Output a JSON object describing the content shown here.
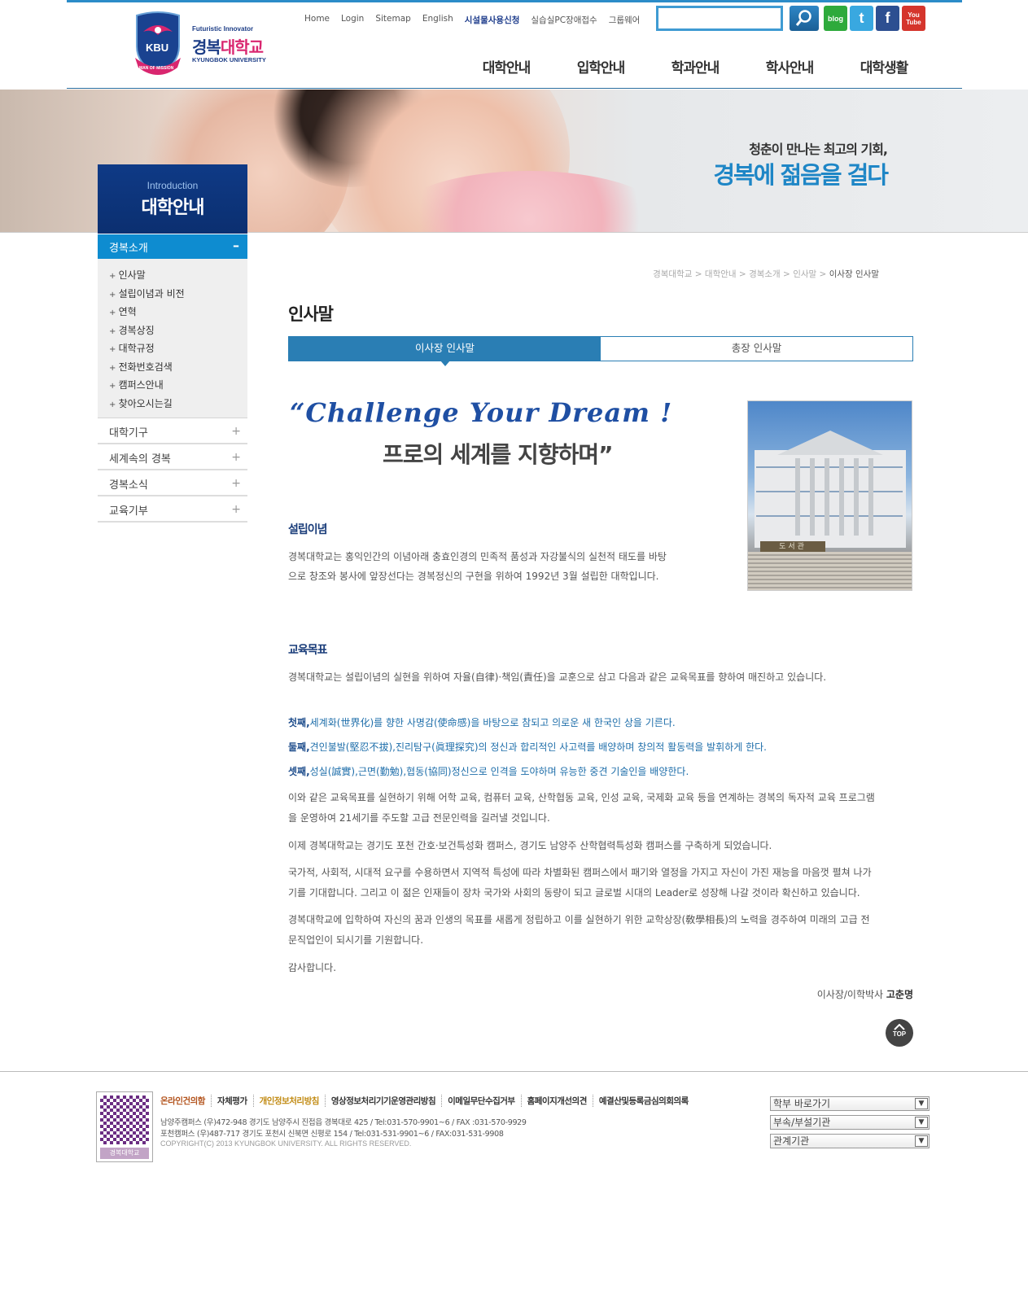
{
  "header": {
    "logo": {
      "sub": "Futuristic Innovator",
      "main_a": "경복",
      "main_b": "대학교",
      "eng": "KYUNGBOK UNIVERSITY",
      "emblem_text": "KBU",
      "ribbon_text": "MAN OF MISSION"
    },
    "util_links": [
      "Home",
      "Login",
      "Sitemap",
      "English",
      "시설물사용신청",
      "실습실PC장애접수",
      "그룹웨어"
    ],
    "search": {
      "placeholder": ""
    },
    "sns": [
      "blog",
      "t",
      "f",
      "You Tube"
    ],
    "gnb": [
      "대학안내",
      "입학안내",
      "학과안내",
      "학사안내",
      "대학생활"
    ]
  },
  "banner": {
    "copy1": "청춘이 만나는 최고의 기회,",
    "copy2": "경복에 젊음을 걸다",
    "section_en": "Introduction",
    "section_ko": "대학안내"
  },
  "lnb": {
    "head": "경복소개",
    "head_toggle": "–",
    "sub": [
      "인사말",
      "설립이념과 비전",
      "연혁",
      "경복상징",
      "대학규정",
      "전화번호검색",
      "캠퍼스안내",
      "찾아오시는길"
    ],
    "items": [
      "대학기구",
      "세계속의 경복",
      "경복소식",
      "교육기부"
    ],
    "toggle": "+"
  },
  "location": {
    "crumbs": [
      "경복대학교",
      "대학안내",
      "경복소개",
      "인사말"
    ],
    "current": "이사장 인사말",
    "sep": ">"
  },
  "content": {
    "title": "인사말",
    "tabs": [
      "이사장 인사말",
      "총장 인사말"
    ],
    "slogan_en": "“Challenge Your Dream !",
    "slogan_ko": "프로의 세계를 지향하며”",
    "photo_sign": "도서관",
    "s1_title": "설립이념",
    "s1_p1": "경복대학교는 홍익인간의 이념아래 충효인경의 민족적 품성과 자강불식의 실천적 태도를 바탕",
    "s1_p2": "으로 창조와 봉사에 앞장선다는 경복정신의 구현을 위하여 1992년 3월 설립한 대학입니다.",
    "s2_title": "교육목표",
    "s2_intro": "경복대학교는 설립이념의 실현을 위하여 자율(自律)·책임(責任)을 교훈으로 삼고 다음과 같은 교육목표를 향하여 매진하고 있습니다.",
    "goals": [
      {
        "num": "첫째,",
        "text": "세계화(世界化)를 향한 사명감(使命感)을 바탕으로 참되고 의로운 새 한국인 상을 기른다."
      },
      {
        "num": "둘째,",
        "text": "견인불발(堅忍不拔),진리탐구(眞理探究)의 정신과 합리적인 사고력를 배양하며 창의적 활동력을 발휘하게 한다."
      },
      {
        "num": "셋째,",
        "text": "성실(誠實),근면(勤勉),협동(協同)정신으로 인격을 도야하며 유능한 중견 기술인을 배양한다."
      }
    ],
    "p3a": "이와 같은 교육목표를 실현하기 위해 어학 교육, 컴퓨터 교육, 산학협동 교육, 인성 교육, 국제화 교육 등을 연계하는 경복의 독자적 교육 프로그램",
    "p3b": "을 운영하여 21세기를 주도할 고급 전문인력을 길러낼 것입니다.",
    "p4": "이제 경복대학교는 경기도 포천 간호·보건특성화 캠퍼스, 경기도 남양주 산학협력특성화 캠퍼스를 구축하게 되었습니다.",
    "p5a": "국가적, 사회적, 시대적 요구를 수용하면서 지역적 특성에 따라 차별화된 캠퍼스에서 패기와 열정을 가지고 자신이 가진 재능을 마음껏 펼쳐 나가",
    "p5b": "기를 기대합니다. 그리고 이 젊은 인재들이 장차 국가와 사회의 동량이 되고 글로벌 시대의 Leader로 성장해 나갈 것이라 확신하고 있습니다.",
    "p6a": " 경복대학교에 입학하여 자신의 꿈과 인생의 목표를 새롭게 정립하고 이를 실현하기 위한 교학상장(敎學相長)의 노력을 경주하여 미래의 고급 전",
    "p6b": "문직업인이 되시기를 기원합니다.",
    "thanks": "감사합니다.",
    "sign_role": "이사장/이학박사 ",
    "sign_name": "고춘명",
    "top": "TOP"
  },
  "footer": {
    "qr_label": "경복대학교",
    "links": [
      "온라인건의함",
      "자체평가",
      "개인정보처리방침",
      "영상정보처리기기운영관리방침",
      "이메일무단수집거부",
      "홈페이지개선의견",
      "예결산및등록금심의회의록"
    ],
    "addr1": "남양주캠퍼스   (우)472-948 경기도 남양주시 진접읍 경복대로 425 / Tel:031-570-9901~6 / FAX :031-570-9929",
    "addr2": "포천캠퍼스      (우)487-717 경기도 포천시 신북면 신평로 154 / Tel:031-531-9901~6 / FAX:031-531-9908",
    "copyright": "COPYRIGHT(C) 2013 KYUNGBOK UNIVERSITY.  ALL RIGHTS RESERVED.",
    "selects": [
      "학부 바로가기",
      "부속/부설기관",
      "관계기관"
    ]
  },
  "colors": {
    "primary": "#1e86c6",
    "navy": "#0f3a86",
    "tab_active": "#2a7eb4",
    "lnb_active": "#0e8cd0"
  },
  "icons": [
    "search-icon",
    "blog-icon",
    "twitter-icon",
    "facebook-icon",
    "youtube-icon",
    "chevron-down-icon"
  ]
}
